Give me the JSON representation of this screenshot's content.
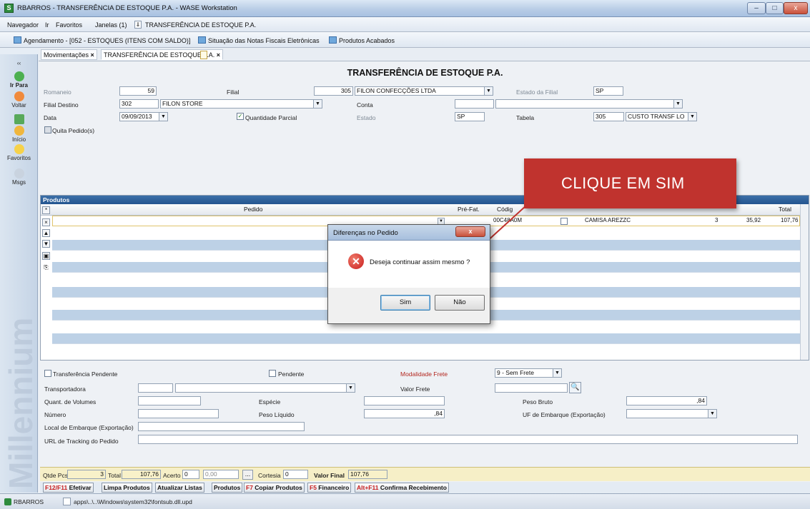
{
  "window": {
    "title": "RBARROS - TRANSFERÊNCIA DE ESTOQUE P.A. - WASE Workstation",
    "btn_min": "–",
    "btn_max": "□",
    "btn_close": "x"
  },
  "menubar": {
    "items": [
      "Navegador",
      "Ir",
      "Favoritos",
      "Janelas (1)"
    ],
    "pin": "⇓",
    "current": "TRANSFERÊNCIA DE ESTOQUE P.A."
  },
  "quicklinks": [
    "Agendamento - [052 - ESTOQUES (ITENS COM SALDO)]",
    "Situação das Notas Fiscais Eletrônicas",
    "Produtos Acabados"
  ],
  "tabs": [
    {
      "label": "Movimentações",
      "close": "×"
    },
    {
      "label": "TRANSFERÊNCIA DE ESTOQUE P.A.",
      "close": "×"
    }
  ],
  "sidebar": {
    "collapse": "‹‹",
    "items": [
      "Ir Para",
      "Voltar",
      "Início",
      "Favoritos",
      "Msgs"
    ]
  },
  "form": {
    "title": "TRANSFERÊNCIA DE ESTOQUE P.A.",
    "romaneio_label": "Romaneio",
    "romaneio": "59",
    "filial_label": "Filial",
    "filial_code": "305",
    "filial_name": "FILON CONFECÇÕES LTDA",
    "estado_filial_label": "Estado da Filial",
    "estado_filial": "SP",
    "filial_destino_label": "Filial Destino",
    "filial_destino_code": "302",
    "filial_destino_name": "FILON STORE",
    "conta_label": "Conta",
    "conta": "",
    "data_label": "Data",
    "data": "09/09/2013",
    "quantidade_parcial_label": "Quantidade Parcial",
    "estado_label": "Estado",
    "estado": "SP",
    "tabela_label": "Tabela",
    "tabela_code": "305",
    "tabela_name": "CUSTO TRANSF LO",
    "quita_pedido_label": "Quita Pedido(s)"
  },
  "grid": {
    "section_title": "Produtos",
    "columns": {
      "pedido": "Pedido",
      "pre_fat": "Pré-Fat.",
      "codigo": "Códig",
      "total": "Total"
    },
    "row": {
      "codigo": "00C48A0M",
      "descricao": "CAMISA AREZZC",
      "qtd": "3",
      "preco": "35,92",
      "total": "107,76"
    },
    "side_buttons": [
      "*",
      "×",
      "▲",
      "▼",
      "▣",
      "⎘"
    ]
  },
  "dialog": {
    "title": "Diferenças no Pedido",
    "close": "x",
    "icon": "error-icon",
    "message": "Deseja continuar assim mesmo ?",
    "yes": "Sim",
    "no": "Não"
  },
  "callout": "CLIQUE EM SIM",
  "lower": {
    "transferencia_pendente": "Transferência Pendente",
    "pendente": "Pendente",
    "modalidade_frete_label": "Modalidade Frete",
    "modalidade_frete": "9 - Sem Frete",
    "transportadora_label": "Transportadora",
    "valor_frete_label": "Valor Frete",
    "quant_volumes_label": "Quant. de Volumes",
    "especie_label": "Espécie",
    "peso_bruto_label": "Peso Bruto",
    "peso_bruto": ",84",
    "numero_label": "Número",
    "peso_liquido_label": "Peso Líquido",
    "peso_liquido": ",84",
    "uf_embarque_label": "UF de Embarque (Exportação)",
    "local_embarque_label": "Local de Embarque (Exportação)",
    "url_tracking_label": "URL de Tracking do Pedido"
  },
  "totals": {
    "qtde_pcs_label": "Qtde Pcs",
    "qtde_pcs": "3",
    "total_label": "Total",
    "total": "107,76",
    "acerto_label": "Acerto",
    "acerto": "0",
    "acerto_val": "0,00",
    "more": "...",
    "cortesia_label": "Cortesia",
    "cortesia": "0",
    "valor_final_label": "Valor Final",
    "valor_final": "107,76"
  },
  "fnbuttons": [
    {
      "key": "F12/F11",
      "label": "Efetivar"
    },
    {
      "key": "",
      "label": "Limpa Produtos"
    },
    {
      "key": "",
      "label": "Atualizar Listas"
    },
    {
      "key": "",
      "label": "Produtos"
    },
    {
      "key": "F7",
      "label": "Copiar Produtos"
    },
    {
      "key": "F5",
      "label": "Financeiro"
    },
    {
      "key": "Alt+F11",
      "label": "Confirma Recebimento"
    }
  ],
  "status": {
    "user": "RBARROS",
    "path": "apps\\..\\..\\Windows\\system32\\fontsub.dll.upd"
  },
  "watermark": "Millennium",
  "colors": {
    "accent": "#24558f",
    "callout": "#c0332e",
    "totals_bg": "#f6efc7"
  }
}
